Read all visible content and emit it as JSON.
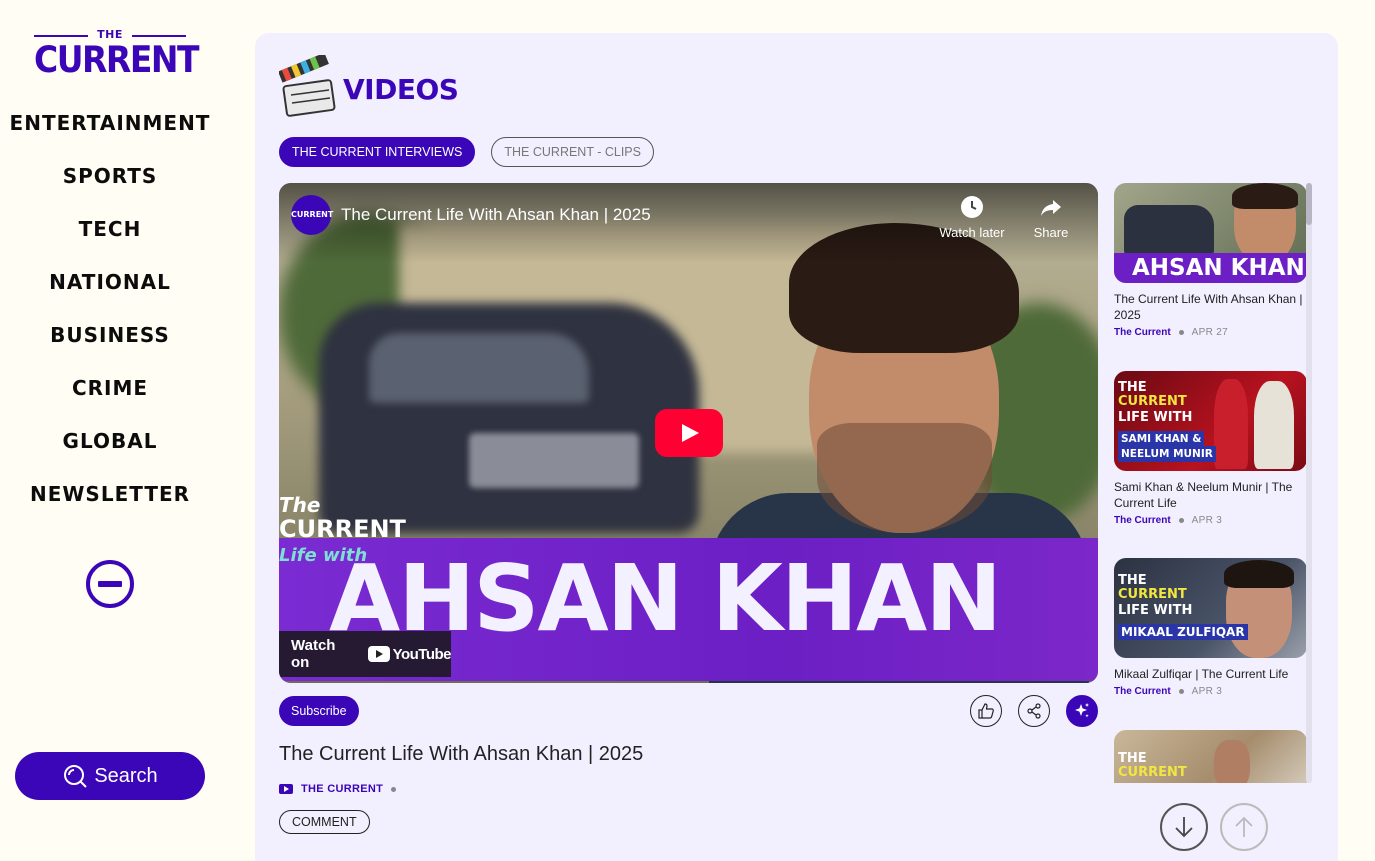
{
  "logo": {
    "the": "THE",
    "name": "CURRENT"
  },
  "nav": [
    "ENTERTAINMENT",
    "SPORTS",
    "TECH",
    "NATIONAL",
    "BUSINESS",
    "CRIME",
    "GLOBAL",
    "NEWSLETTER"
  ],
  "search": {
    "label": "Search"
  },
  "section": {
    "title": "VIDEOS"
  },
  "tabs": [
    {
      "label": "THE CURRENT INTERVIEWS",
      "active": true
    },
    {
      "label": "THE CURRENT - CLIPS",
      "active": false
    }
  ],
  "player": {
    "channel_avatar_text": "CURRENT",
    "title": "The Current Life With Ahsan Khan | 2025",
    "watch_later": "Watch later",
    "share": "Share",
    "watch_on": "Watch on",
    "youtube": "YouTube",
    "banner_the": "The",
    "banner_current": "CURRENT",
    "banner_life": "Life with",
    "banner_name": "AHSAN KHAN"
  },
  "video": {
    "subscribe": "Subscribe",
    "title": "The Current Life With Ahsan Khan | 2025",
    "channel": "THE CURRENT",
    "comment": "COMMENT"
  },
  "playlist": [
    {
      "title": "The Current Life With Ahsan Khan | 2025",
      "channel": "The Current",
      "date": "APR 27",
      "thumb_name": "AHSAN KHAN"
    },
    {
      "title": "Sami Khan & Neelum Munir | The Current Life",
      "channel": "The Current",
      "date": "APR 3",
      "thumb_line1": "THE",
      "thumb_line2": "CURRENT",
      "thumb_line3": "LIFE WITH",
      "thumb_line4": "SAMI KHAN &",
      "thumb_line5": "NEELUM MUNIR"
    },
    {
      "title": "Mikaal Zulfiqar | The Current Life",
      "channel": "The Current",
      "date": "APR 3",
      "thumb_line1": "THE",
      "thumb_line2": "CURRENT",
      "thumb_line3": "LIFE WITH",
      "thumb_line4": "MIKAAL ZULFIQAR"
    },
    {
      "thumb_line1": "THE",
      "thumb_line2": "CURRENT"
    }
  ],
  "icons": {
    "search": "search-icon",
    "collapse": "minus-circle-icon",
    "play": "youtube-play-icon",
    "clock": "clock-icon",
    "share": "share-arrow-icon",
    "like": "thumbs-up-icon",
    "share_nodes": "share-nodes-icon",
    "ai": "sparkles-icon",
    "down": "arrow-down-icon",
    "up": "arrow-up-icon"
  },
  "colors": {
    "brand": "#3b06b8",
    "background": "#fffdf4",
    "panel": "#f2effe",
    "youtube_red": "#ff0033"
  }
}
